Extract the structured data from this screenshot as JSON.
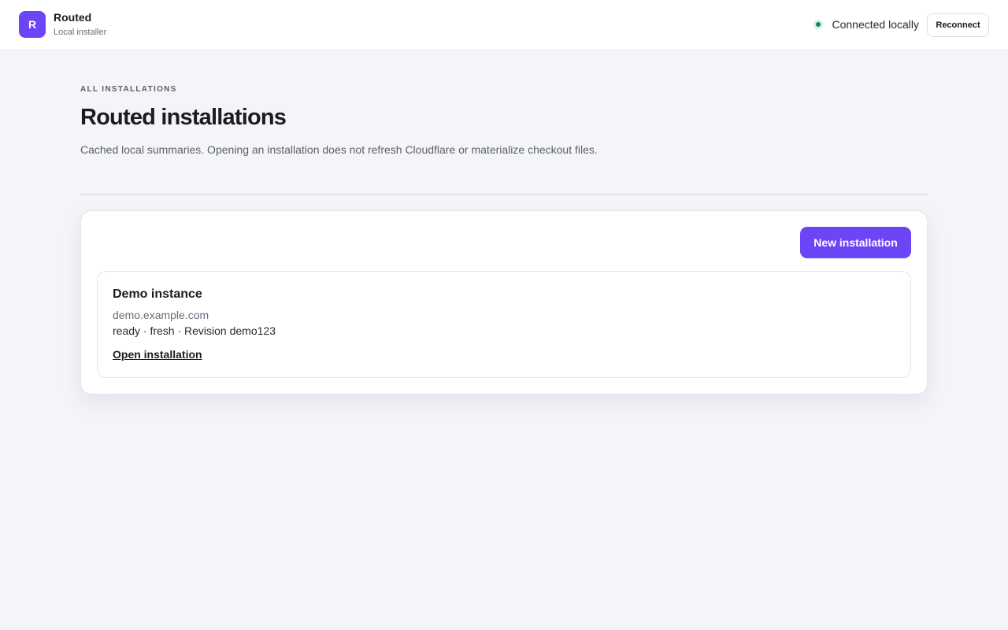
{
  "header": {
    "logo_letter": "R",
    "app_name": "Routed",
    "app_subtitle": "Local installer",
    "status_text": "Connected locally",
    "status_color": "#0e8a5f",
    "reconnect_label": "Reconnect"
  },
  "page": {
    "eyebrow": "ALL INSTALLATIONS",
    "title": "Routed installations",
    "description": "Cached local summaries. Opening an installation does not refresh Cloudflare or materialize checkout files."
  },
  "panel": {
    "new_button_label": "New installation",
    "accent_color": "#6b45f6",
    "installations": [
      {
        "name": "Demo instance",
        "domain": "demo.example.com",
        "meta": "ready · fresh · Revision demo123",
        "open_label": "Open installation"
      }
    ]
  }
}
